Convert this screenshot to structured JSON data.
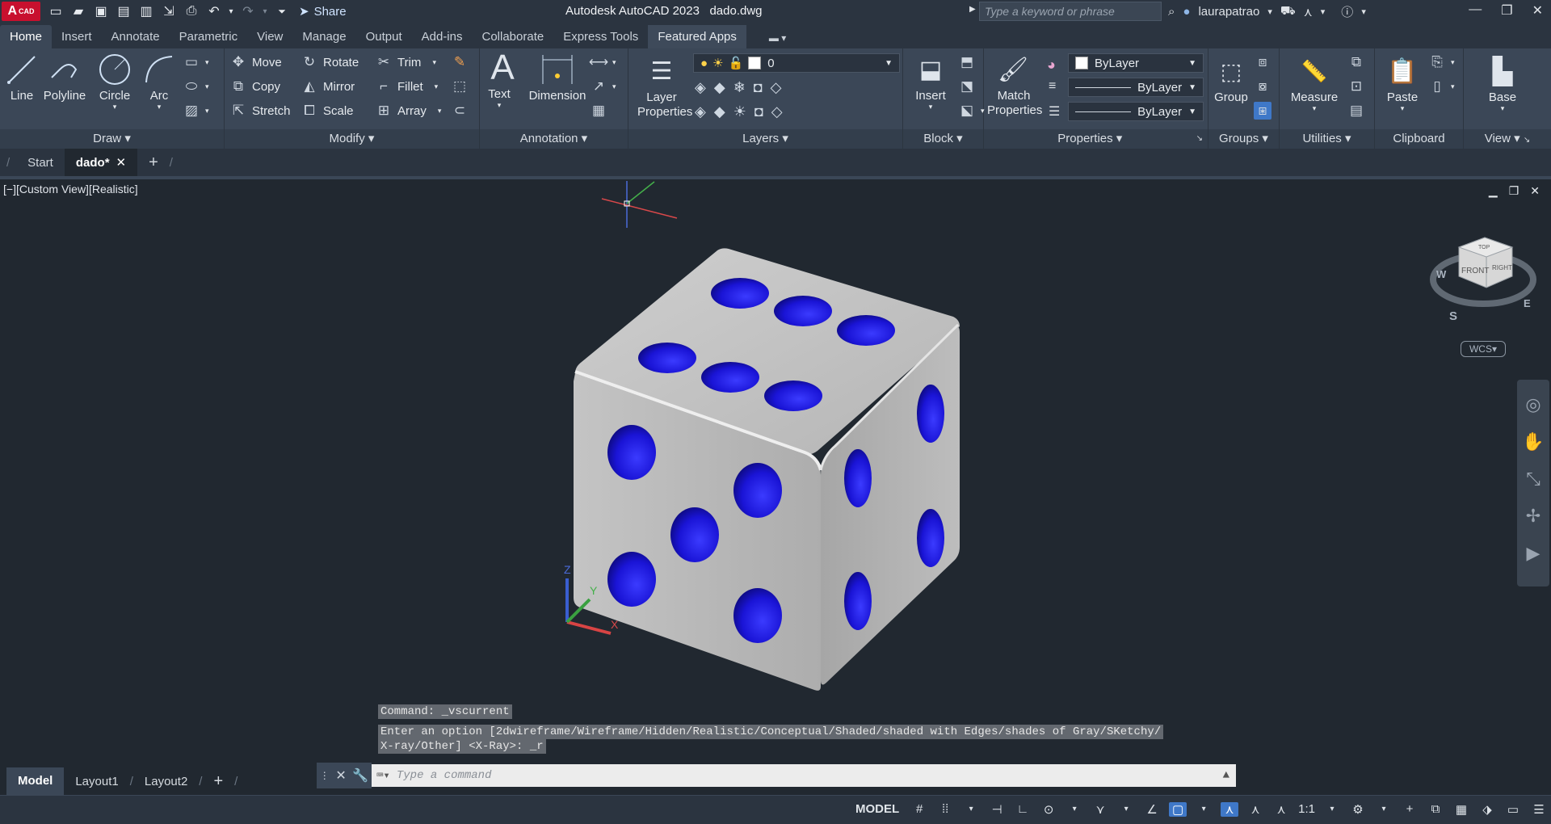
{
  "app": {
    "badge": "A",
    "badge_small": "CAD",
    "title": "Autodesk AutoCAD 2023",
    "filename": "dado.dwg",
    "share_label": "Share",
    "search_placeholder": "Type a keyword or phrase",
    "username": "laurapatrao"
  },
  "ribbon_tabs": [
    "Home",
    "Insert",
    "Annotate",
    "Parametric",
    "View",
    "Manage",
    "Output",
    "Add-ins",
    "Collaborate",
    "Express Tools",
    "Featured Apps"
  ],
  "panels": {
    "draw": {
      "title": "Draw",
      "line": "Line",
      "polyline": "Polyline",
      "circle": "Circle",
      "arc": "Arc"
    },
    "modify": {
      "title": "Modify",
      "move": "Move",
      "rotate": "Rotate",
      "trim": "Trim",
      "copy": "Copy",
      "mirror": "Mirror",
      "fillet": "Fillet",
      "stretch": "Stretch",
      "scale": "Scale",
      "array": "Array"
    },
    "annotation": {
      "title": "Annotation",
      "text": "Text",
      "dimension": "Dimension"
    },
    "layers": {
      "title": "Layers",
      "layer_properties": "Layer Properties",
      "current_layer": "0"
    },
    "block": {
      "title": "Block",
      "insert": "Insert"
    },
    "properties": {
      "title": "Properties",
      "match": "Match Properties",
      "color": "ByLayer",
      "linetype": "ByLayer",
      "lineweight": "ByLayer"
    },
    "groups": {
      "title": "Groups",
      "group": "Group"
    },
    "utilities": {
      "title": "Utilities",
      "measure": "Measure"
    },
    "clipboard": {
      "title": "Clipboard",
      "paste": "Paste"
    },
    "view": {
      "title": "View",
      "base": "Base"
    }
  },
  "file_tabs": {
    "start": "Start",
    "active": "dado*"
  },
  "viewport": {
    "label": "[−][Custom View][Realistic]",
    "viewcube_top": "TOP",
    "viewcube_front": "FRONT",
    "viewcube_right": "RIGHT",
    "compass_w": "W",
    "compass_s": "S",
    "compass_e": "E",
    "wcs": "WCS",
    "axis_z": "Z",
    "axis_y": "Y",
    "axis_x": "X"
  },
  "command": {
    "history_1": "Command: _vscurrent",
    "history_2": "Enter an option [2dwireframe/Wireframe/Hidden/Realistic/Conceptual/Shaded/shaded with Edges/shades of Gray/SKetchy/",
    "history_3": "X-ray/Other] <X-Ray>: _r",
    "placeholder": "Type a command"
  },
  "layout_tabs": [
    "Model",
    "Layout1",
    "Layout2"
  ],
  "status": {
    "model": "MODEL",
    "scale": "1:1"
  },
  "colors": {
    "accent": "#3f78c8",
    "pip": "#1a14d6",
    "die": "#b9b9b9"
  }
}
